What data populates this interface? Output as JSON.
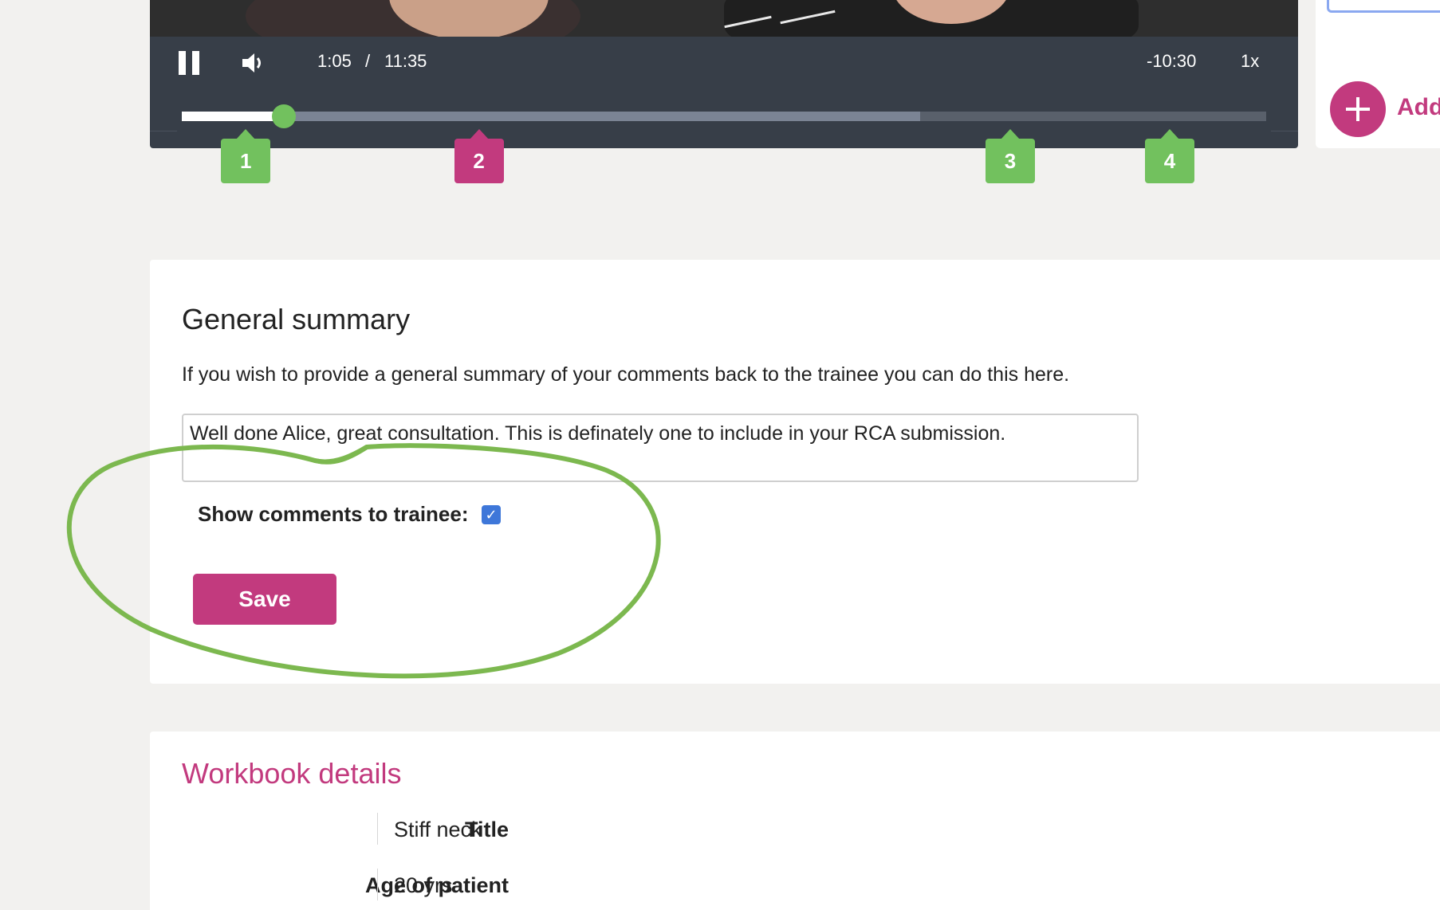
{
  "player": {
    "current_time": "1:05",
    "separator": "/",
    "total_time": "11:35",
    "remaining_time": "-10:30",
    "speed": "1x",
    "played_fraction": 0.094,
    "buffered_fraction": 0.681,
    "markers": [
      {
        "label": "1",
        "color": "green",
        "fraction": 0.059
      },
      {
        "label": "2",
        "color": "pink",
        "fraction": 0.274
      },
      {
        "label": "3",
        "color": "green",
        "fraction": 0.764
      },
      {
        "label": "4",
        "color": "green",
        "fraction": 0.911
      }
    ]
  },
  "side_panel": {
    "add_label": "Add"
  },
  "summary": {
    "title": "General summary",
    "intro": "If you wish to provide a general summary of your comments back to the trainee you can do this here.",
    "comment_value": "Well done Alice, great consultation. This is definately one to include in your RCA submission.",
    "show_comments_label": "Show comments to trainee:",
    "show_comments_checked": true,
    "save_label": "Save"
  },
  "workbook": {
    "title": "Workbook details",
    "rows": [
      {
        "label": "Title",
        "value": "Stiff neck"
      },
      {
        "label": "Age of patient",
        "value": "20 yrs"
      }
    ]
  },
  "colors": {
    "accent_pink": "#c23a7e",
    "marker_green": "#72c15e",
    "player_bg": "#373e48",
    "checkbox_blue": "#3e77d9",
    "annotation_green": "#7cb84f"
  }
}
